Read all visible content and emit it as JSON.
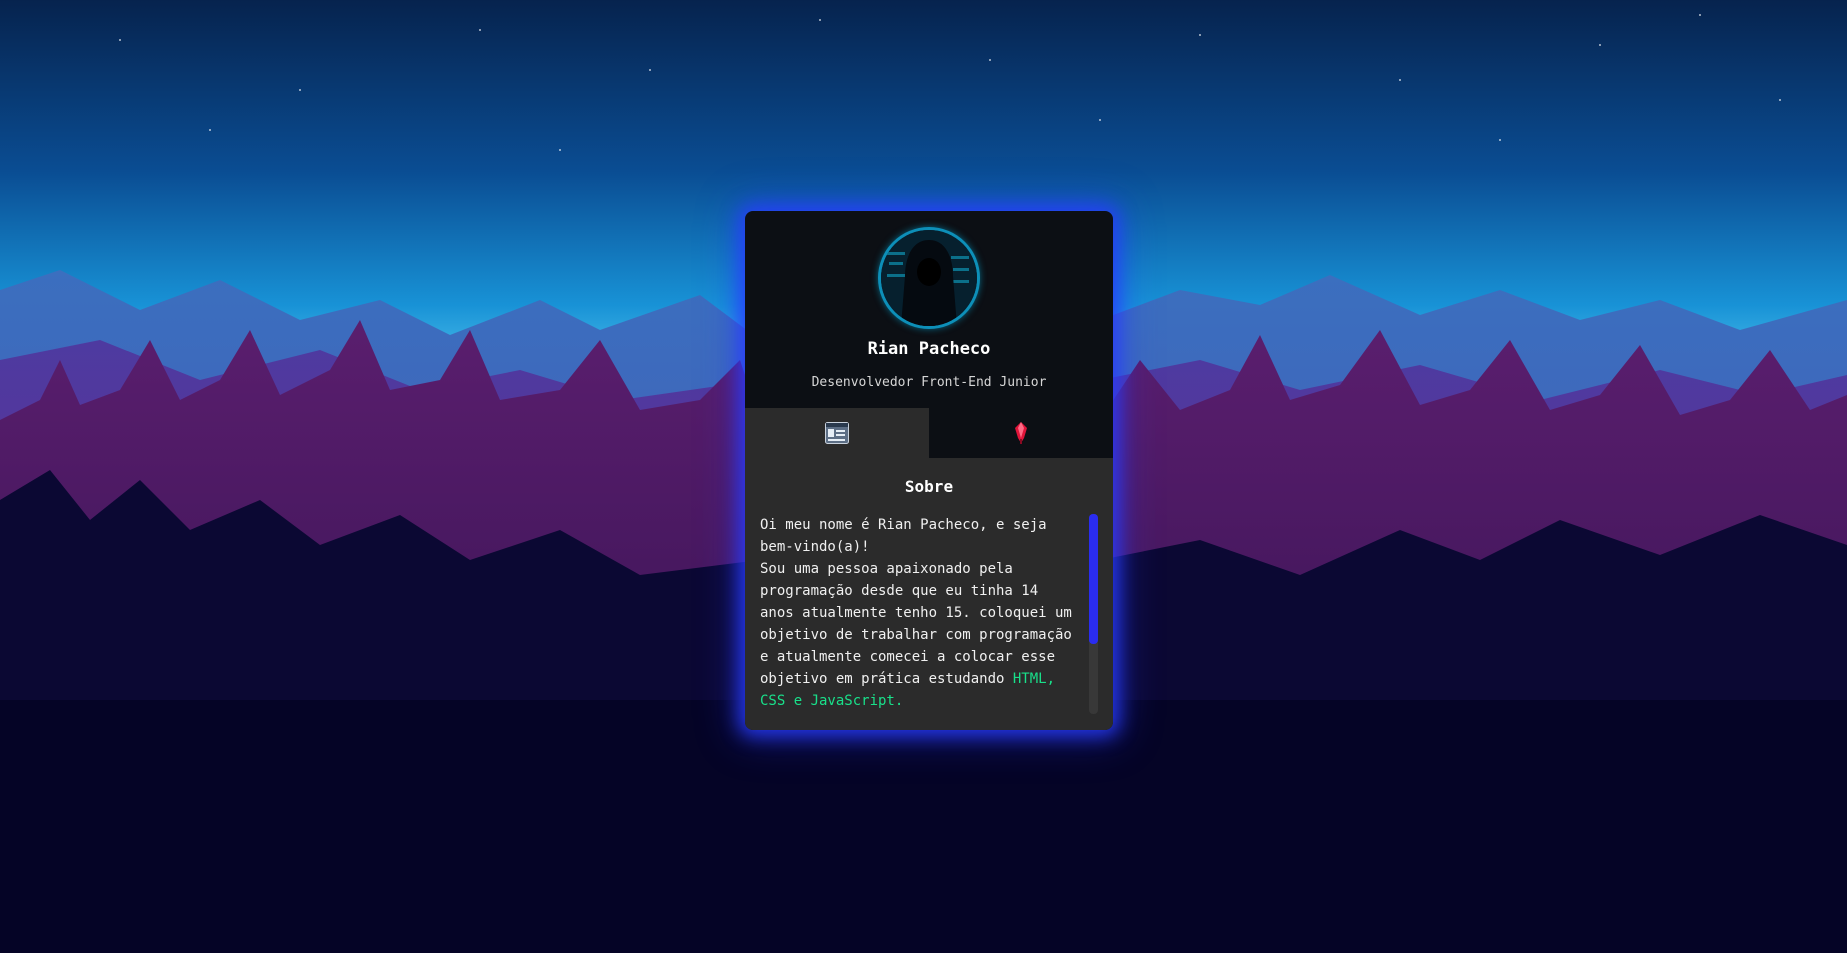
{
  "profile": {
    "name": "Rian Pacheco",
    "role": "Desenvolvedor Front-End Junior",
    "avatar_icon": "hooded-hacker-avatar"
  },
  "tabs": [
    {
      "icon": "about-card-icon",
      "active": true
    },
    {
      "icon": "red-crystal-icon",
      "active": false
    }
  ],
  "about": {
    "title": "Sobre",
    "greeting": "Oi meu nome é Rian Pacheco, e seja bem-vindo(a)!",
    "body": "Sou uma pessoa apaixonado pela programação desde que eu tinha 14 anos atualmente tenho 15. coloquei um objetivo de trabalhar com programação e atualmente comecei a colocar esse objetivo em prática estudando ",
    "highlight": "HTML, CSS e JavaScript."
  },
  "colors": {
    "glow": "#2838ff",
    "accent_text": "#19e08a",
    "scroll_thumb": "#2a2cf0",
    "card_bg": "#0c0f14",
    "panel_bg": "#2b2b2b"
  }
}
